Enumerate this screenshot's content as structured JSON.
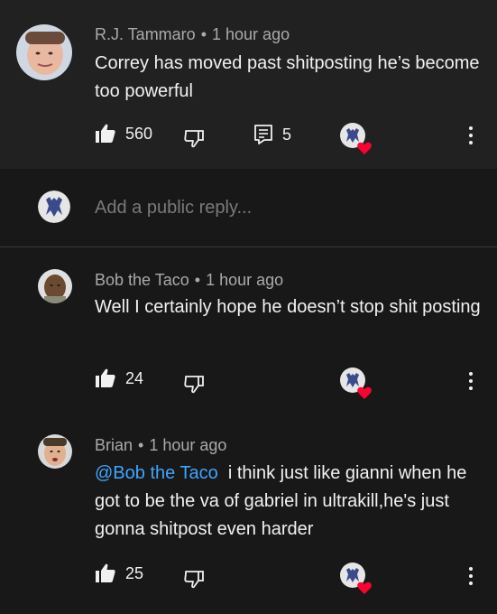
{
  "comments": [
    {
      "author": "R.J. Tammaro",
      "time": "1 hour ago",
      "text": "Correy has moved past shitposting he’s become too powerful",
      "likes": "560",
      "replies": "5"
    },
    {
      "author": "Bob the Taco",
      "time": "1 hour ago",
      "text": "Well I certainly hope he doesn’t stop shit posting",
      "likes": "24"
    },
    {
      "author": "Brian",
      "time": "1 hour ago",
      "mention": "@Bob the Taco",
      "text": "i think just like gianni when he got to be the va of gabriel in ultrakill,he's just gonna shitpost even harder",
      "likes": "25"
    }
  ],
  "reply": {
    "placeholder": "Add a public reply..."
  },
  "colors": {
    "background": "#181818",
    "card": "#212121",
    "mention": "#3ea6ff",
    "heart": "#ff0033"
  }
}
